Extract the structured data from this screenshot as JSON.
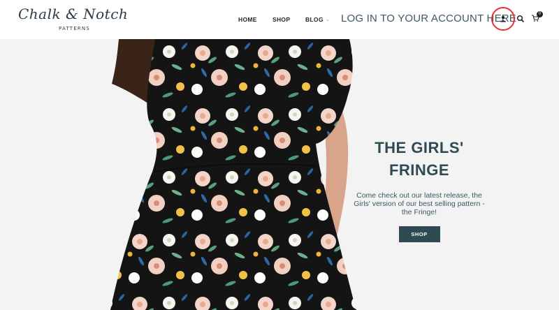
{
  "header": {
    "logo_script": "Chalk & Notch",
    "logo_sub": "PATTERNS",
    "nav": {
      "home": "HOME",
      "shop": "SHOP",
      "blog": "BLOG"
    },
    "login_text": "LOG IN TO YOUR ACCOUNT HERE",
    "cart_count": "0",
    "icons": [
      "user-icon",
      "search-icon",
      "cart-icon",
      "chevron-down-icon"
    ]
  },
  "hero": {
    "title_line1": "THE GIRLS'",
    "title_line2": "FRINGE",
    "text": "Come check out our latest release, the Girls' version of our best selling pattern - the Fringe!",
    "button": "SHOP"
  },
  "colors": {
    "accent": "#2f4a52",
    "highlight_circle": "#e8302a"
  }
}
